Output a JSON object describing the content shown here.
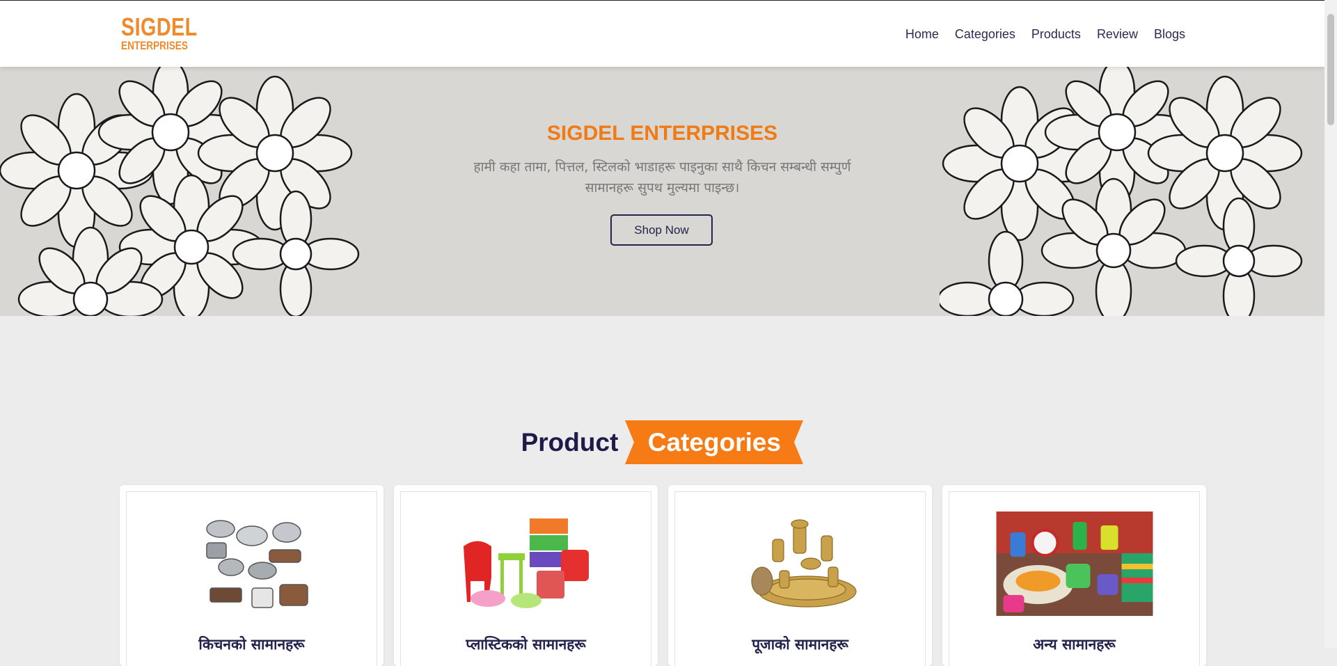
{
  "header": {
    "logo_top": "SIGDEL",
    "logo_bottom": "ENTERPRISES",
    "nav": [
      "Home",
      "Categories",
      "Products",
      "Review",
      "Blogs"
    ]
  },
  "hero": {
    "title": "SIGDEL ENTERPRISES",
    "text": "हामी कहा तामा, पित्तल, स्टिलको भाडाहरू पाइनुका साथै किचन सम्बन्धी सम्पुर्ण सामानहरू सुपथ मुल्यमा पाइन्छ।",
    "button": "Shop Now"
  },
  "section": {
    "title_plain": "Product",
    "title_highlight": "Categories"
  },
  "categories": [
    {
      "label": "किचनको सामानहरू",
      "icon": "kitchenware-image"
    },
    {
      "label": "प्लास्टिकको सामानहरू",
      "icon": "plastic-goods-image"
    },
    {
      "label": "पूजाको सामानहरू",
      "icon": "puja-items-image"
    },
    {
      "label": "अन्य सामानहरू",
      "icon": "other-goods-image"
    }
  ],
  "colors": {
    "accent": "#f07a14",
    "navy": "#1e1b4b",
    "hero_bg": "#d8d7d3",
    "page_bg": "#ececec"
  }
}
